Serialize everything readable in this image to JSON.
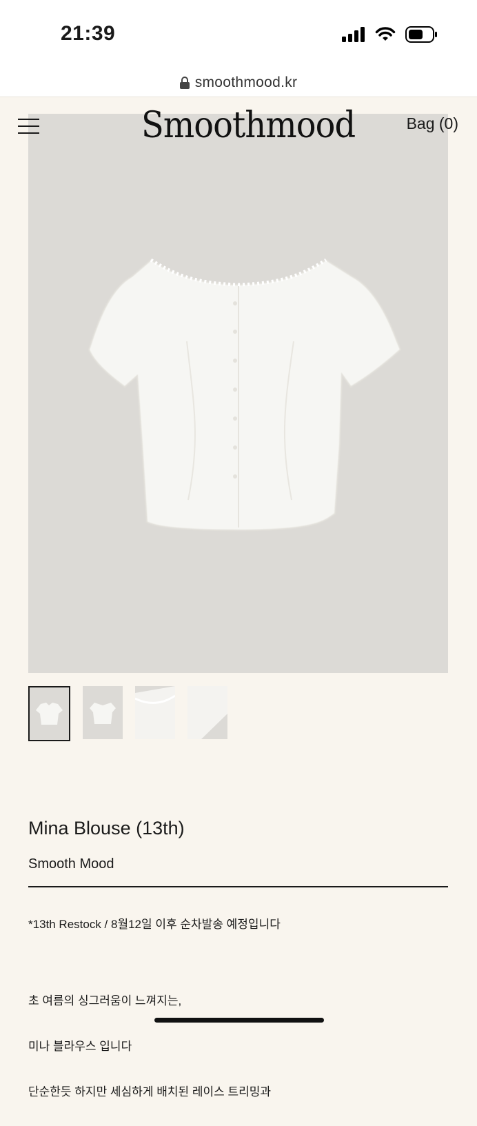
{
  "status_bar": {
    "time": "21:39"
  },
  "browser": {
    "url": "smoothmood.kr"
  },
  "header": {
    "logo": "Smoothmood",
    "bag_label": "Bag (0)"
  },
  "product": {
    "title": "Mina Blouse (13th)",
    "brand": "Smooth Mood",
    "notice": "*13th Restock / 8월12일 이후 순차발송 예정입니다",
    "description": [
      "초 여름의 싱그러움이 느껴지는,",
      "미나 블라우스 입니다",
      "단순한듯 하지만 세심하게 배치된 레이스 트리밍과"
    ],
    "thumbnail_count": 4,
    "active_thumbnail": 1
  },
  "colors": {
    "background": "#f9f5ee",
    "image_bg": "#dcdad6",
    "text": "#1a1a1a"
  },
  "icons": [
    "signal-icon",
    "wifi-icon",
    "battery-icon",
    "lock-icon",
    "menu-icon"
  ]
}
